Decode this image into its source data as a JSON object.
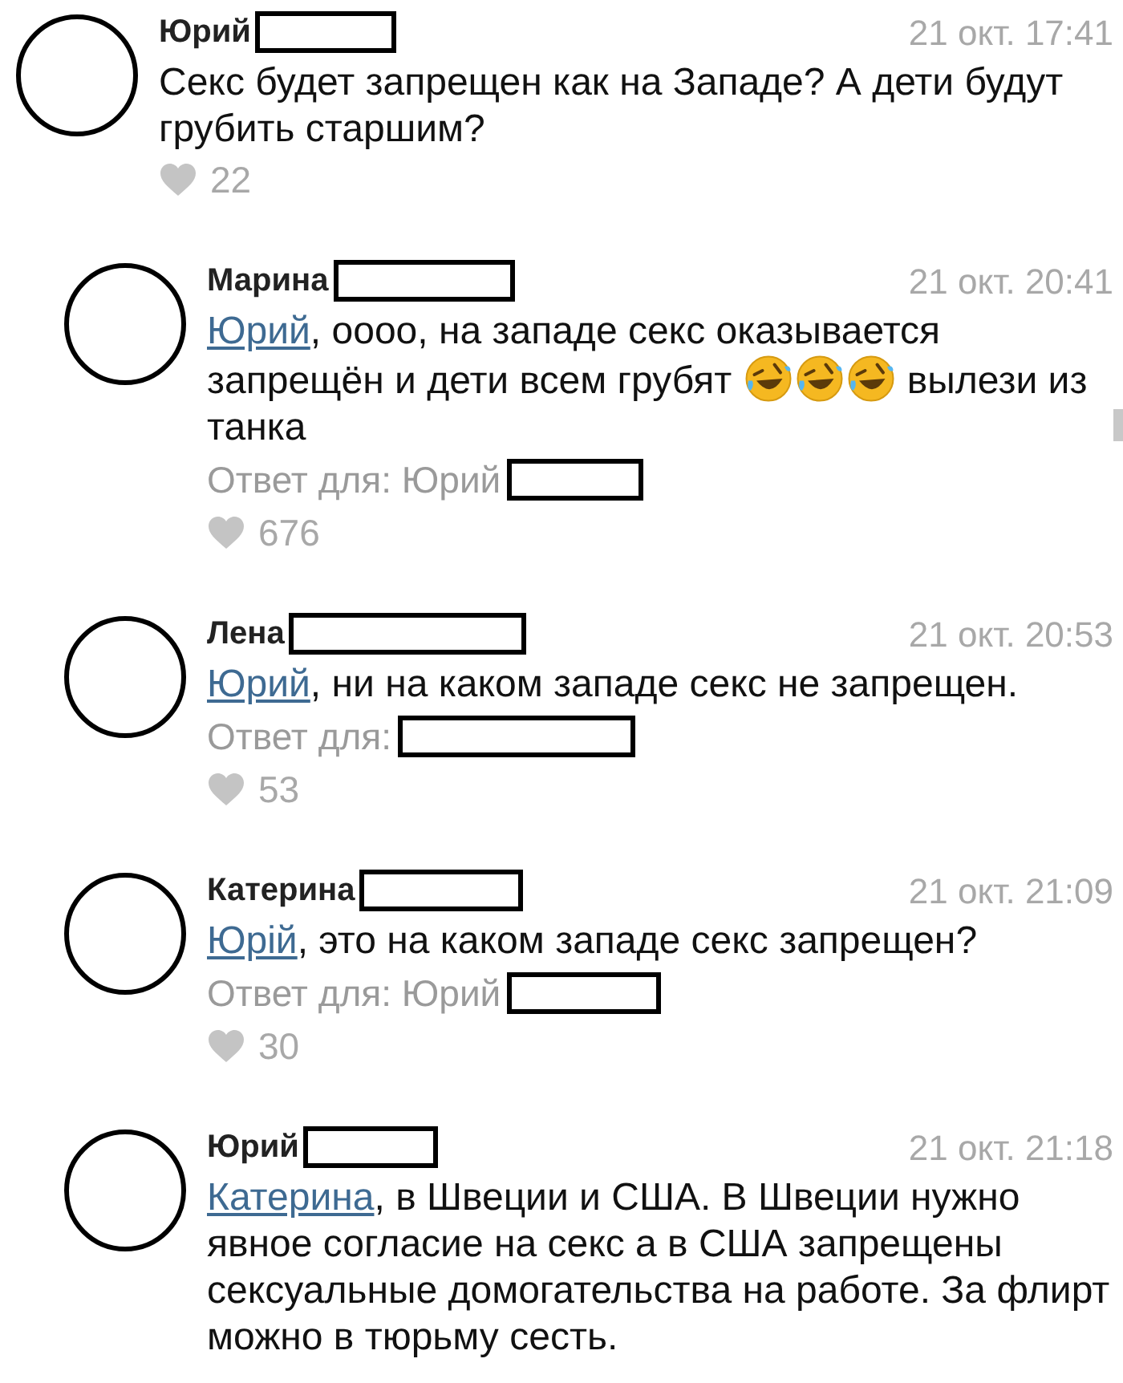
{
  "comments": [
    {
      "author": "Юрий",
      "date": "21 окт. 17:41",
      "reply": false,
      "body": [
        {
          "kind": "text",
          "text": "Секс будет запрещен как на Западе? А дети будут грубить старшим?"
        }
      ],
      "likes": "22"
    },
    {
      "author": "Марина",
      "date": "21 окт. 20:41",
      "reply": true,
      "body": [
        {
          "kind": "mention",
          "text": "Юрий"
        },
        {
          "kind": "text",
          "text": ", оооо, на западе секс оказывается запрещён и дети всем грубят "
        },
        {
          "kind": "emoji"
        },
        {
          "kind": "emoji"
        },
        {
          "kind": "emoji"
        },
        {
          "kind": "text",
          "text": " вылези из танка"
        }
      ],
      "reply_to": "Ответ для: Юрий",
      "likes": "676"
    },
    {
      "author": "Лена",
      "date": "21 окт. 20:53",
      "reply": true,
      "body": [
        {
          "kind": "mention",
          "text": "Юрий"
        },
        {
          "kind": "text",
          "text": ", ни на каком западе секс не запрещен."
        }
      ],
      "reply_to": "Ответ для:",
      "likes": "53"
    },
    {
      "author": "Катерина",
      "date": "21 окт. 21:09",
      "reply": true,
      "body": [
        {
          "kind": "mention",
          "text": "Юрій"
        },
        {
          "kind": "text",
          "text": ", это на каком западе секс запрещен?"
        }
      ],
      "reply_to": "Ответ для: Юрий",
      "likes": "30"
    },
    {
      "author": "Юрий",
      "date": "21 окт. 21:18",
      "reply": true,
      "body": [
        {
          "kind": "mention",
          "text": "Катерина"
        },
        {
          "kind": "text",
          "text": ", в Швеции и США. В Швеции нужно явное согласие на секс а в США запрещены сексуальные домогательства на работе. За флирт можно в тюрьму сесть."
        }
      ]
    }
  ]
}
